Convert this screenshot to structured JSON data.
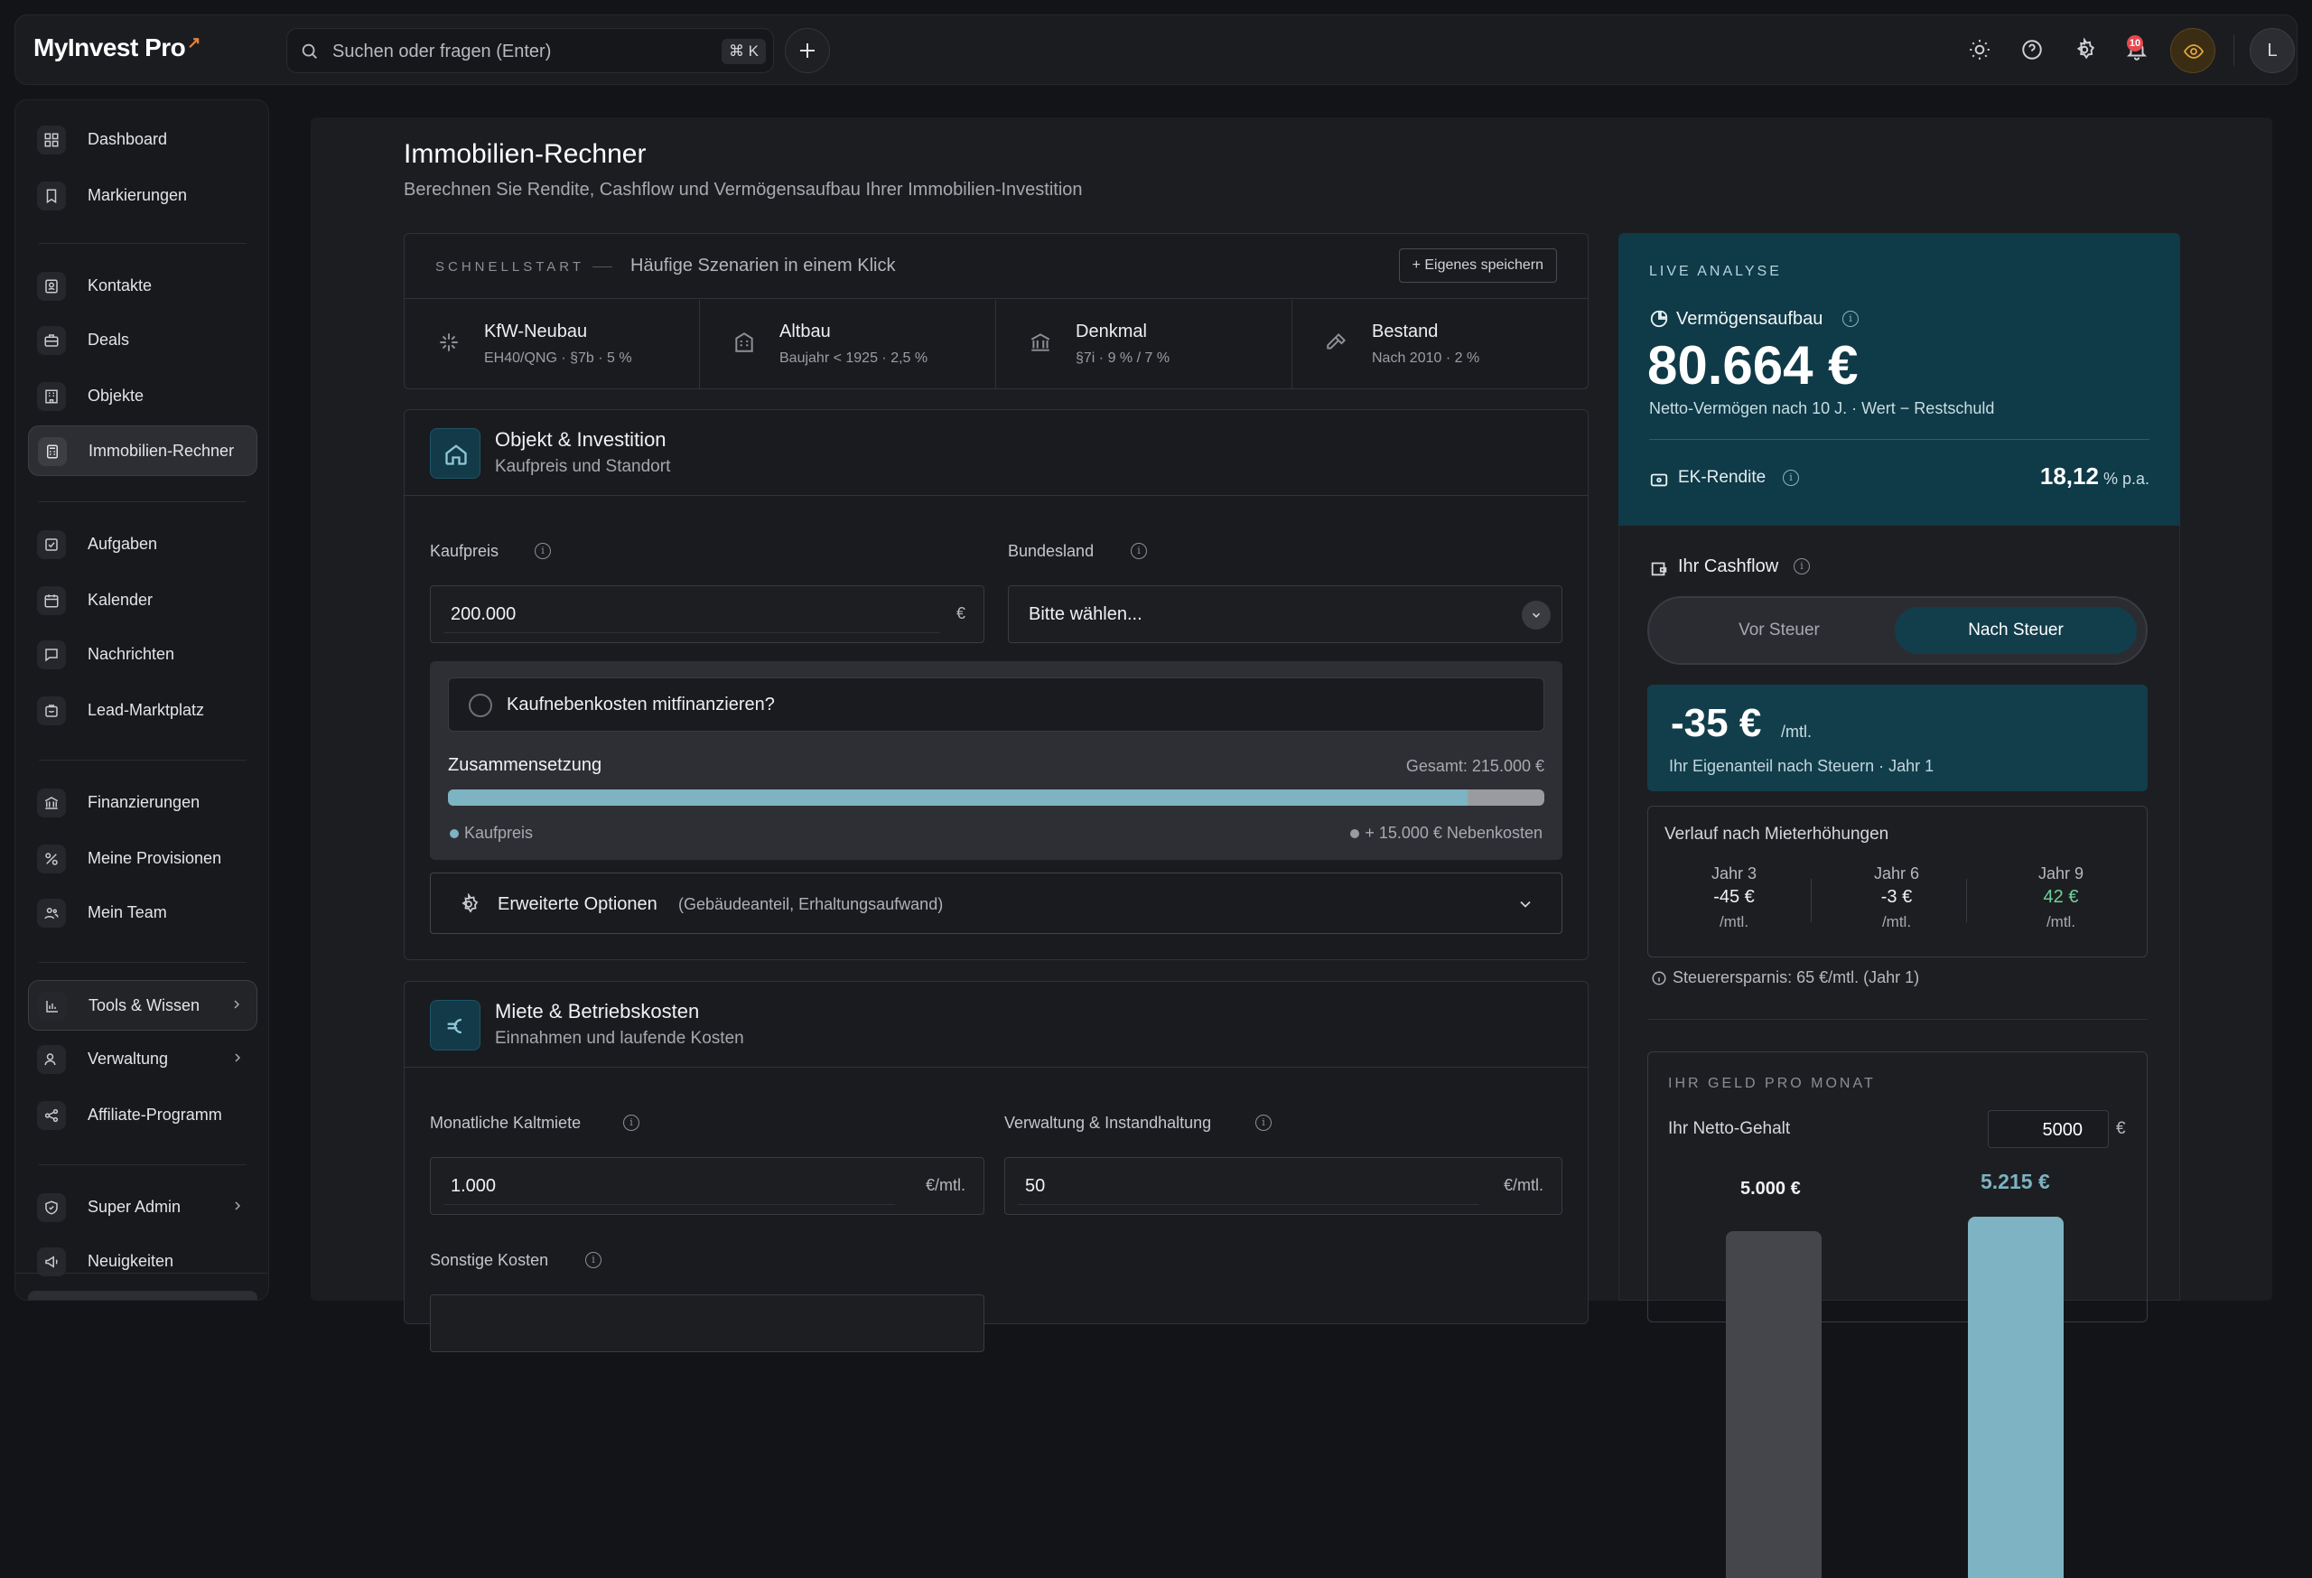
{
  "app": {
    "name": "MyInvest Pro",
    "accent_mark": "↗"
  },
  "search": {
    "placeholder": "Suchen oder fragen (Enter)",
    "shortcut": "⌘ K"
  },
  "notifications": {
    "count": "10"
  },
  "user": {
    "initial": "L"
  },
  "sidebar": {
    "items": [
      {
        "label": "Dashboard",
        "icon": "grid-icon"
      },
      {
        "label": "Markierungen",
        "icon": "bookmark-icon"
      },
      {
        "label": "Kontakte",
        "icon": "contact-icon"
      },
      {
        "label": "Deals",
        "icon": "briefcase-icon"
      },
      {
        "label": "Objekte",
        "icon": "building-icon"
      },
      {
        "label": "Immobilien-Rechner",
        "icon": "calculator-icon",
        "active": true
      },
      {
        "label": "Aufgaben",
        "icon": "checkbox-icon"
      },
      {
        "label": "Kalender",
        "icon": "calendar-icon"
      },
      {
        "label": "Nachrichten",
        "icon": "message-icon"
      },
      {
        "label": "Lead-Marktplatz",
        "icon": "cart-icon"
      },
      {
        "label": "Finanzierungen",
        "icon": "bank-icon"
      },
      {
        "label": "Meine Provisionen",
        "icon": "percent-icon"
      },
      {
        "label": "Mein Team",
        "icon": "team-icon"
      },
      {
        "label": "Tools & Wissen",
        "icon": "chart-icon"
      },
      {
        "label": "Verwaltung",
        "icon": "user-cog-icon"
      },
      {
        "label": "Affiliate-Programm",
        "icon": "share-icon"
      },
      {
        "label": "Super Admin",
        "icon": "shield-icon"
      },
      {
        "label": "Neuigkeiten",
        "icon": "megaphone-icon"
      }
    ]
  },
  "page": {
    "title": "Immobilien-Rechner",
    "subtitle": "Berechnen Sie Rendite, Cashflow und Vermögensaufbau Ihrer Immobilien-Investition"
  },
  "quickstart": {
    "label": "SCHNELLSTART",
    "desc": "Häufige Szenarien in einem Klick",
    "save": "+ Eigenes speichern",
    "items": [
      {
        "name": "KfW-Neubau",
        "meta": "EH40/QNG · §7b · 5 %"
      },
      {
        "name": "Altbau",
        "meta": "Baujahr < 1925 · 2,5 %"
      },
      {
        "name": "Denkmal",
        "meta": "§7i · 9 % / 7 %"
      },
      {
        "name": "Bestand",
        "meta": "Nach 2010 · 2 %"
      }
    ]
  },
  "objekt": {
    "title": "Objekt & Investition",
    "subtitle": "Kaufpreis und Standort",
    "kaufpreis_label": "Kaufpreis",
    "kaufpreis_value": "200.000",
    "kaufpreis_unit": "€",
    "bundesland_label": "Bundesland",
    "bundesland_value": "Bitte wählen...",
    "finance_question": "Kaufnebenkosten mitfinanzieren?",
    "comp_title": "Zusammensetzung",
    "comp_total": "Gesamt: 215.000 €",
    "comp_share": 0.93,
    "legend_kaufpreis": "Kaufpreis",
    "legend_neben": "+ 15.000 € Nebenkosten",
    "advanced_label": "Erweiterte Optionen",
    "advanced_hint": "(Gebäudeanteil, Erhaltungsaufwand)"
  },
  "miete": {
    "title": "Miete & Betriebskosten",
    "subtitle": "Einnahmen und laufende Kosten",
    "kalt_label": "Monatliche Kaltmiete",
    "kalt_value": "1.000",
    "kalt_unit": "€/mtl.",
    "verw_label": "Verwaltung & Instandhaltung",
    "verw_value": "50",
    "verw_unit": "€/mtl.",
    "sonstige_label": "Sonstige Kosten"
  },
  "live": {
    "label": "LIVE ANALYSE",
    "verm_label": "Vermögensaufbau",
    "verm_value": "80.664 €",
    "verm_note": "Netto-Vermögen nach 10 J. · Wert − Restschuld",
    "ek_label": "EK-Rendite",
    "ek_value": "18,12",
    "ek_unit": "% p.a."
  },
  "cashflow": {
    "title": "Ihr Cashflow",
    "opt_before": "Vor Steuer",
    "opt_after": "Nach Steuer",
    "value": "-35 €",
    "unit": "/mtl.",
    "note": "Ihr Eigenanteil nach Steuern · Jahr 1",
    "verlauf_title": "Verlauf nach Mieterhöhungen",
    "years": [
      {
        "label": "Jahr 3",
        "value": "-45 €",
        "unit": "/mtl."
      },
      {
        "label": "Jahr 6",
        "value": "-3 €",
        "unit": "/mtl."
      },
      {
        "label": "Jahr 9",
        "value": "42 €",
        "unit": "/mtl."
      }
    ],
    "tax_saving": "Steuerersparnis: 65 €/mtl. (Jahr 1)"
  },
  "money": {
    "label": "IHR GELD PRO MONAT",
    "netto_label": "Ihr Netto-Gehalt",
    "netto_value": "5000",
    "netto_unit": "€",
    "bar1_label": "5.000 €",
    "bar1_value": 5000,
    "bar2_label": "5.215 €",
    "bar2_value": 5215
  },
  "colors": {
    "accent": "#0f3a48",
    "teal": "#7db3c2",
    "positive": "#6fd39a"
  }
}
